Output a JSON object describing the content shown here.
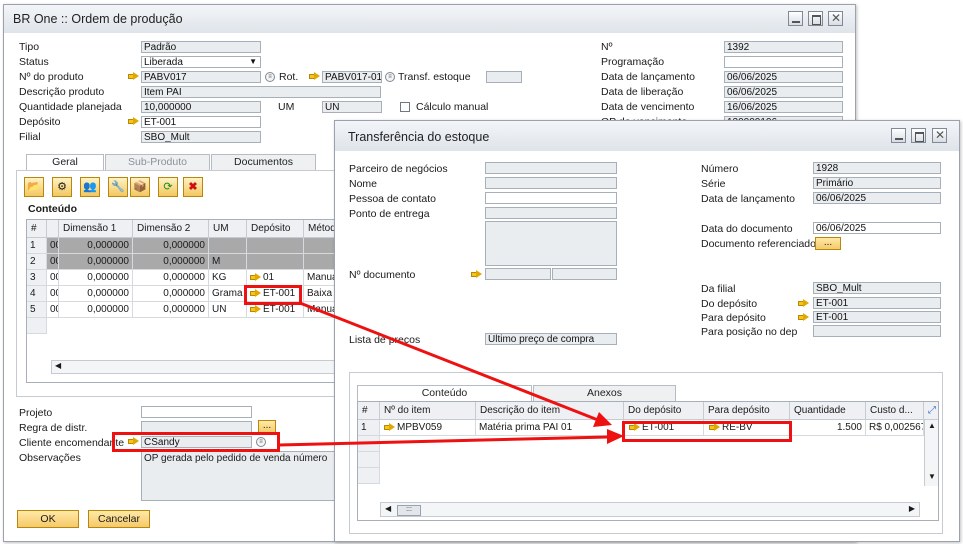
{
  "prod": {
    "title": "BR One :: Ordem de produção",
    "left_labels": [
      "Tipo",
      "Status",
      "Nº do produto",
      "Descrição produto",
      "Quantidade planejada",
      "Depósito",
      "Filial"
    ],
    "tipo": "Padrão",
    "status": "Liberada",
    "produto": "PABV017",
    "rot_label": "Rot.",
    "rot_value": "PABV017-01",
    "transf_label": "Transf. estoque",
    "descricao": "Item PAI",
    "quantidade": "10,000000",
    "um_label": "UM",
    "um_value": "UN",
    "calculo_label": "Cálculo manual",
    "deposito": "ET-001",
    "filial": "SBO_Mult",
    "right_labels": [
      "Nº",
      "Programação",
      "Data de lançamento",
      "Data de liberação",
      "Data de vencimento",
      "OP do vencimento"
    ],
    "numero": "1392",
    "data_lancamento": "06/06/2025",
    "data_liberacao": "06/06/2025",
    "data_vencimento": "16/06/2025",
    "op_vencimento": "130000106",
    "tabs": [
      "Geral",
      "Sub-Produto",
      "Documentos"
    ],
    "conteudo_label": "Conteúdo",
    "grid_headers": [
      "#",
      "",
      "Dimensão 1",
      "Dimensão 2",
      "UM",
      "Depósito",
      "Métod"
    ],
    "grid_rows": [
      {
        "n": "1",
        "c": "00",
        "d1": "0,000000",
        "d2": "0,000000",
        "um": "",
        "dep": "",
        "met": ""
      },
      {
        "n": "2",
        "c": "00",
        "d1": "0,000000",
        "d2": "0,000000",
        "um": "M",
        "dep": "",
        "met": ""
      },
      {
        "n": "3",
        "c": "00",
        "d1": "0,000000",
        "d2": "0,000000",
        "um": "KG",
        "dep": "01",
        "met": "Manua"
      },
      {
        "n": "4",
        "c": "00",
        "d1": "0,000000",
        "d2": "0,000000",
        "um": "Grama",
        "dep": "ET-001",
        "met": "Baixa p"
      },
      {
        "n": "5",
        "c": "00",
        "d1": "0,000000",
        "d2": "0,000000",
        "um": "UN",
        "dep": "ET-001",
        "met": "Manua"
      }
    ],
    "bottom_labels": [
      "Projeto",
      "Regra de distr.",
      "Cliente encomendante",
      "Observações"
    ],
    "cliente": "CSandy",
    "observacoes": "OP gerada pelo pedido de venda número",
    "ok": "OK",
    "cancelar": "Cancelar"
  },
  "transf": {
    "title": "Transferência do estoque",
    "left_labels": [
      "Parceiro de negócios",
      "Nome",
      "Pessoa de contato",
      "Ponto de entrega"
    ],
    "ndoc_label": "Nº documento",
    "lista_label": "Lista de preços",
    "lista_value": "Último preço de compra",
    "right_labels": [
      "Número",
      "Série",
      "Data de lançamento"
    ],
    "numero": "1928",
    "serie": "Primário",
    "data_lancamento": "06/06/2025",
    "data_doc_label": "Data do documento",
    "data_doc": "06/06/2025",
    "doc_ref_label": "Documento referenciado",
    "filial_labels": [
      "Da filial",
      "Do depósito",
      "Para depósito",
      "Para posição no dep"
    ],
    "da_filial": "SBO_Mult",
    "do_deposito": "ET-001",
    "para_deposito": "ET-001",
    "tabs": [
      "Conteúdo",
      "Anexos"
    ],
    "grid_headers": [
      "#",
      "Nº do item",
      "Descrição do item",
      "Do depósito",
      "Para depósito",
      "Quantidade",
      "Custo d..."
    ],
    "row": {
      "n": "1",
      "item": "MPBV059",
      "desc": "Matéria prima PAI 01",
      "de": "ET-001",
      "para": "RE-BV",
      "qtd": "1.500",
      "custo": "R$ 0,002567"
    },
    "dots": "..."
  }
}
